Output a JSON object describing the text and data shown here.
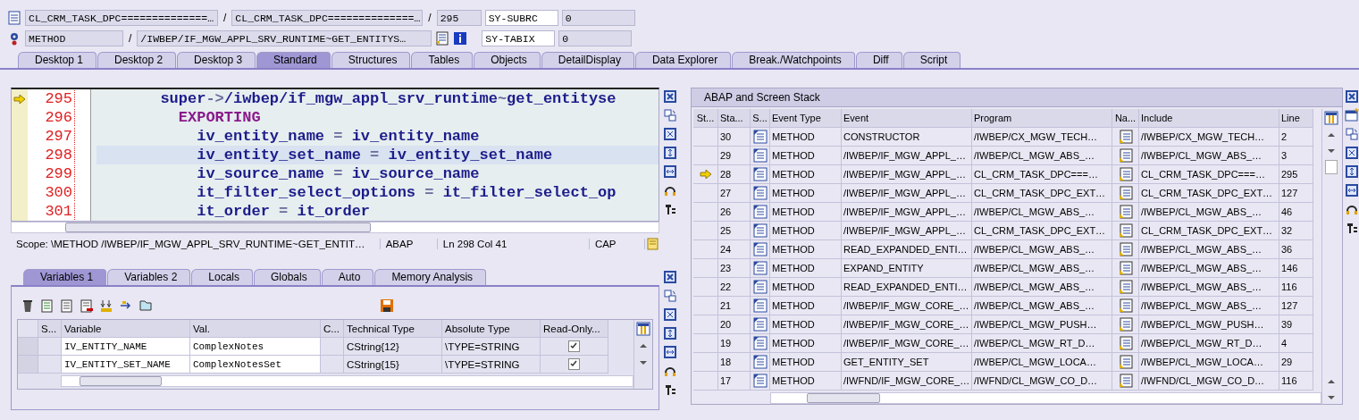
{
  "header": {
    "row1": {
      "program": "CL_CRM_TASK_DPC==============…",
      "sep1": "/",
      "include": "CL_CRM_TASK_DPC==============…",
      "sep2": "/",
      "line": "295",
      "sys_field": "SY-SUBRC",
      "sys_value": "0"
    },
    "row2": {
      "event_type": "METHOD",
      "sep": "/",
      "event": "/IWBEP/IF_MGW_APPL_SRV_RUNTIME~GET_ENTITYS…",
      "sys_field": "SY-TABIX",
      "sys_value": "0"
    }
  },
  "tabs": [
    {
      "label": "Desktop 1",
      "selected": false
    },
    {
      "label": "Desktop 2",
      "selected": false
    },
    {
      "label": "Desktop 3",
      "selected": false
    },
    {
      "label": "Standard",
      "selected": true
    },
    {
      "label": "Structures",
      "selected": false
    },
    {
      "label": "Tables",
      "selected": false
    },
    {
      "label": "Objects",
      "selected": false
    },
    {
      "label": "DetailDisplay",
      "selected": false
    },
    {
      "label": "Data Explorer",
      "selected": false
    },
    {
      "label": "Break./Watchpoints",
      "selected": false
    },
    {
      "label": "Diff",
      "selected": false
    },
    {
      "label": "Script",
      "selected": false
    }
  ],
  "code": {
    "lines": [
      {
        "number": "295",
        "current": true,
        "cursor_line": false,
        "tokens": [
          {
            "text": "       super",
            "kind": "id"
          },
          {
            "text": "->",
            "kind": "op"
          },
          {
            "text": "/iwbep/if_mgw_appl_srv_runtime",
            "kind": "id"
          },
          {
            "text": "~",
            "kind": "op"
          },
          {
            "text": "get_entityse",
            "kind": "id"
          }
        ]
      },
      {
        "number": "296",
        "current": false,
        "cursor_line": false,
        "tokens": [
          {
            "text": "         EXPORTING",
            "kind": "keyword"
          }
        ]
      },
      {
        "number": "297",
        "current": false,
        "cursor_line": false,
        "tokens": [
          {
            "text": "           iv_entity_name ",
            "kind": "id"
          },
          {
            "text": "=",
            "kind": "op"
          },
          {
            "text": " iv_entity_name",
            "kind": "id"
          }
        ]
      },
      {
        "number": "298",
        "current": false,
        "cursor_line": true,
        "tokens": [
          {
            "text": "           iv_entity_set_name ",
            "kind": "id"
          },
          {
            "text": "=",
            "kind": "op"
          },
          {
            "text": " iv_entity_set_name",
            "kind": "id"
          }
        ]
      },
      {
        "number": "299",
        "current": false,
        "cursor_line": false,
        "tokens": [
          {
            "text": "           iv_source_name ",
            "kind": "id"
          },
          {
            "text": "=",
            "kind": "op"
          },
          {
            "text": " iv_source_name",
            "kind": "id"
          }
        ]
      },
      {
        "number": "300",
        "current": false,
        "cursor_line": false,
        "tokens": [
          {
            "text": "           it_filter_select_options ",
            "kind": "id"
          },
          {
            "text": "=",
            "kind": "op"
          },
          {
            "text": " it_filter_select_op",
            "kind": "id"
          }
        ]
      },
      {
        "number": "301",
        "current": false,
        "cursor_line": false,
        "tokens": [
          {
            "text": "           it_order ",
            "kind": "id"
          },
          {
            "text": "=",
            "kind": "op"
          },
          {
            "text": " it_order",
            "kind": "id"
          }
        ]
      }
    ],
    "status": {
      "scope": "Scope: \\METHOD /IWBEP/IF_MGW_APPL_SRV_RUNTIME~GET_ENTIT…",
      "language": "ABAP",
      "position": "Ln 298 Col  41",
      "caps": "CAP"
    }
  },
  "variable_tabs": [
    {
      "label": "Variables 1",
      "selected": true
    },
    {
      "label": "Variables 2",
      "selected": false
    },
    {
      "label": "Locals",
      "selected": false
    },
    {
      "label": "Globals",
      "selected": false
    },
    {
      "label": "Auto",
      "selected": false
    },
    {
      "label": "Memory Analysis",
      "selected": false
    }
  ],
  "variables": {
    "columns": [
      "S...",
      "Variable",
      "Val.",
      "C...",
      "Technical Type",
      "Absolute Type",
      "Read-Only..."
    ],
    "rows": [
      {
        "variable": "IV_ENTITY_NAME",
        "value": "ComplexNotes",
        "technical_type": "CString{12}",
        "absolute_type": "\\TYPE=STRING",
        "read_only": true
      },
      {
        "variable": "IV_ENTITY_SET_NAME",
        "value": "ComplexNotesSet",
        "technical_type": "CString{15}",
        "absolute_type": "\\TYPE=STRING",
        "read_only": true
      }
    ]
  },
  "stack": {
    "title": "ABAP and Screen Stack",
    "columns": [
      "St...",
      "Sta...",
      "S...",
      "Event Type",
      "Event",
      "Program",
      "Na...",
      "Include",
      "Line"
    ],
    "rows": [
      {
        "current": false,
        "stack": "30",
        "event_type": "METHOD",
        "event": "CONSTRUCTOR",
        "program": "/IWBEP/CX_MGW_TECH…",
        "include": "/IWBEP/CX_MGW_TECH…",
        "line": "2"
      },
      {
        "current": false,
        "stack": "29",
        "event_type": "METHOD",
        "event": "/IWBEP/IF_MGW_APPL_…",
        "program": "/IWBEP/CL_MGW_ABS_…",
        "include": "/IWBEP/CL_MGW_ABS_…",
        "line": "3"
      },
      {
        "current": true,
        "stack": "28",
        "event_type": "METHOD",
        "event": "/IWBEP/IF_MGW_APPL_…",
        "program": "CL_CRM_TASK_DPC===…",
        "include": "CL_CRM_TASK_DPC===…",
        "line": "295"
      },
      {
        "current": false,
        "stack": "27",
        "event_type": "METHOD",
        "event": "/IWBEP/IF_MGW_APPL_…",
        "program": "CL_CRM_TASK_DPC_EXT…",
        "include": "CL_CRM_TASK_DPC_EXT…",
        "line": "127"
      },
      {
        "current": false,
        "stack": "26",
        "event_type": "METHOD",
        "event": "/IWBEP/IF_MGW_APPL_…",
        "program": "/IWBEP/CL_MGW_ABS_…",
        "include": "/IWBEP/CL_MGW_ABS_…",
        "line": "46"
      },
      {
        "current": false,
        "stack": "25",
        "event_type": "METHOD",
        "event": "/IWBEP/IF_MGW_APPL_…",
        "program": "CL_CRM_TASK_DPC_EXT…",
        "include": "CL_CRM_TASK_DPC_EXT…",
        "line": "32"
      },
      {
        "current": false,
        "stack": "24",
        "event_type": "METHOD",
        "event": "READ_EXPANDED_ENTI…",
        "program": "/IWBEP/CL_MGW_ABS_…",
        "include": "/IWBEP/CL_MGW_ABS_…",
        "line": "36"
      },
      {
        "current": false,
        "stack": "23",
        "event_type": "METHOD",
        "event": "EXPAND_ENTITY",
        "program": "/IWBEP/CL_MGW_ABS_…",
        "include": "/IWBEP/CL_MGW_ABS_…",
        "line": "146"
      },
      {
        "current": false,
        "stack": "22",
        "event_type": "METHOD",
        "event": "READ_EXPANDED_ENTI…",
        "program": "/IWBEP/CL_MGW_ABS_…",
        "include": "/IWBEP/CL_MGW_ABS_…",
        "line": "116"
      },
      {
        "current": false,
        "stack": "21",
        "event_type": "METHOD",
        "event": "/IWBEP/IF_MGW_CORE_…",
        "program": "/IWBEP/CL_MGW_ABS_…",
        "include": "/IWBEP/CL_MGW_ABS_…",
        "line": "127"
      },
      {
        "current": false,
        "stack": "20",
        "event_type": "METHOD",
        "event": "/IWBEP/IF_MGW_CORE_…",
        "program": "/IWBEP/CL_MGW_PUSH…",
        "include": "/IWBEP/CL_MGW_PUSH…",
        "line": "39"
      },
      {
        "current": false,
        "stack": "19",
        "event_type": "METHOD",
        "event": "/IWBEP/IF_MGW_CORE_…",
        "program": "/IWBEP/CL_MGW_RT_D…",
        "include": "/IWBEP/CL_MGW_RT_D…",
        "line": "4"
      },
      {
        "current": false,
        "stack": "18",
        "event_type": "METHOD",
        "event": "GET_ENTITY_SET",
        "program": "/IWBEP/CL_MGW_LOCA…",
        "include": "/IWBEP/CL_MGW_LOCA…",
        "line": "29"
      },
      {
        "current": false,
        "stack": "17",
        "event_type": "METHOD",
        "event": "/IWFND/IF_MGW_CORE_…",
        "program": "/IWFND/CL_MGW_CO_D…",
        "include": "/IWFND/CL_MGW_CO_D…",
        "line": "116"
      }
    ]
  }
}
